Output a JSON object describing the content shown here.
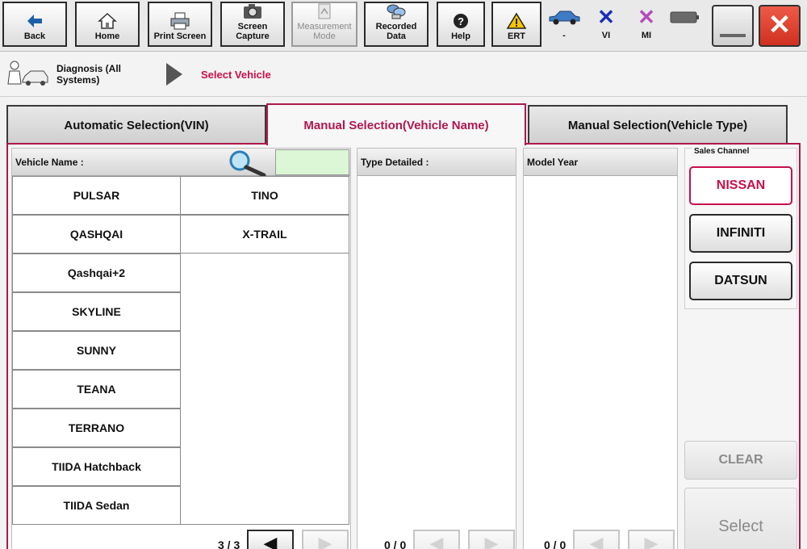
{
  "toolbar": {
    "back": "Back",
    "home": "Home",
    "print_screen": "Print Screen",
    "screen_capture": "Screen Capture",
    "measurement_mode": "Measurement Mode",
    "recorded_data": "Recorded Data",
    "help": "Help",
    "ert": "ERT"
  },
  "status": {
    "vehicle": "-",
    "vi": "VI",
    "mi": "MI"
  },
  "breadcrumb": {
    "step1": "Diagnosis (All Systems)",
    "step2": "Select Vehicle"
  },
  "tabs": {
    "automatic": "Automatic Selection(VIN)",
    "manual_name": "Manual Selection(Vehicle Name)",
    "manual_type": "Manual Selection(Vehicle Type)"
  },
  "vehicle_list": {
    "header": "Vehicle Name :",
    "search_value": "",
    "col1": [
      "PULSAR",
      "QASHQAI",
      "Qashqai+2",
      "SKYLINE",
      "SUNNY",
      "TEANA",
      "TERRANO",
      "TIIDA Hatchback",
      "TIIDA Sedan"
    ],
    "col2": [
      "TINO",
      "X-TRAIL"
    ],
    "page": "3 / 3"
  },
  "type_detailed": {
    "header": "Type Detailed :",
    "page": "0 / 0"
  },
  "model_year": {
    "header": "Model Year",
    "page": "0 / 0"
  },
  "sales_channel": {
    "legend": "Sales Channel",
    "options": [
      "NISSAN",
      "INFINITI",
      "DATSUN"
    ],
    "selected": "NISSAN"
  },
  "actions": {
    "clear": "CLEAR",
    "select": "Select"
  },
  "colors": {
    "accent": "#c8104a",
    "ert_warning": "#f5c400",
    "close_red": "#e03a2a",
    "status_x": "#1a2fb8",
    "status_mi": "#b54bb8"
  },
  "icons": [
    "back-arrow-icon",
    "home-icon",
    "printer-icon",
    "camera-icon",
    "measurement-icon",
    "recorded-data-icon",
    "help-icon",
    "warning-icon",
    "car-icon",
    "battery-icon",
    "minimize-icon",
    "close-icon",
    "magnifier-icon",
    "mechanic-car-icon"
  ]
}
